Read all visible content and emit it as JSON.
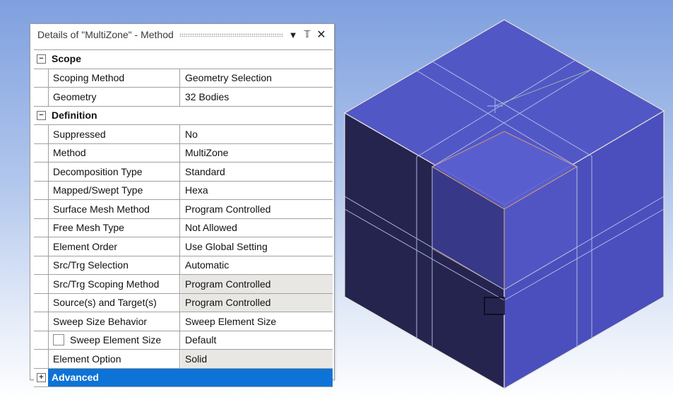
{
  "panel": {
    "title": "Details of \"MultiZone\" - Method",
    "icons": [
      "dropdown-arrow-icon",
      "pin-icon",
      "close-icon"
    ]
  },
  "groups": {
    "scope": {
      "label": "Scope",
      "toggle": "−"
    },
    "definition": {
      "label": "Definition",
      "toggle": "−"
    },
    "advanced": {
      "label": "Advanced",
      "toggle": "+"
    }
  },
  "rows": [
    {
      "label": "Scoping Method",
      "value": "Geometry Selection"
    },
    {
      "label": "Geometry",
      "value": "32 Bodies"
    },
    {
      "label": "Suppressed",
      "value": "No"
    },
    {
      "label": "Method",
      "value": "MultiZone"
    },
    {
      "label": "Decomposition Type",
      "value": "Standard"
    },
    {
      "label": "Mapped/Swept Type",
      "value": "Hexa"
    },
    {
      "label": "Surface Mesh Method",
      "value": "Program Controlled"
    },
    {
      "label": "Free Mesh Type",
      "value": "Not Allowed"
    },
    {
      "label": "Element Order",
      "value": "Use Global Setting"
    },
    {
      "label": "Src/Trg Selection",
      "value": "Automatic"
    },
    {
      "label": "Src/Trg Scoping Method",
      "value": "Program Controlled"
    },
    {
      "label": "Source(s) and Target(s)",
      "value": "Program Controlled"
    },
    {
      "label": "Sweep Size Behavior",
      "value": "Sweep Element Size"
    },
    {
      "label": "Sweep Element Size",
      "value": "Default"
    },
    {
      "label": "Element Option",
      "value": "Solid"
    }
  ],
  "colors": {
    "selection": "#0d73d6",
    "cube_top": "#5257c6",
    "cube_left": "#25244f",
    "cube_right": "#4a4fbd",
    "readonly_value_bg": "#e8e7e3"
  }
}
